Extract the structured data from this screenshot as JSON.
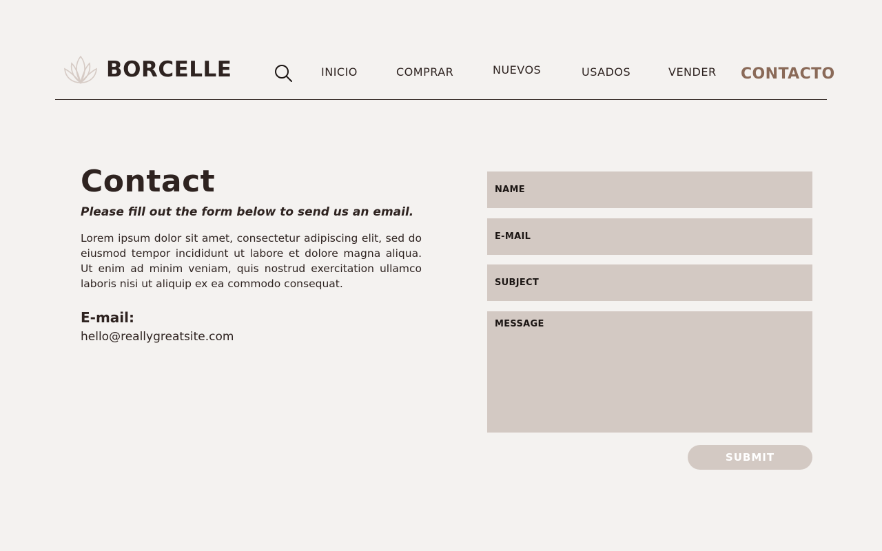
{
  "brand": {
    "name": "BORCELLE",
    "icon": "lotus-logo-icon"
  },
  "nav": {
    "search_icon": "search-icon",
    "items": [
      {
        "label": "INICIO"
      },
      {
        "label": "COMPRAR"
      },
      {
        "label": "NUEVOS"
      },
      {
        "label": "USADOS"
      },
      {
        "label": "VENDER"
      },
      {
        "label": "CONTACTO",
        "active": true
      }
    ]
  },
  "contact": {
    "title": "Contact",
    "subtitle": "Please fill out the form below to send us an email.",
    "body": "Lorem ipsum dolor sit amet, consectetur adipiscing elit, sed do eiusmod tempor incididunt ut labore et dolore magna aliqua. Ut enim ad minim veniam, quis nostrud exercitation ullamco laboris nisi ut aliquip ex ea commodo consequat.",
    "email_label": "E-mail:",
    "email_value": "hello@reallygreatsite.com"
  },
  "form": {
    "name_placeholder": "NAME",
    "email_placeholder": "E-MAIL",
    "subject_placeholder": "SUBJECT",
    "message_placeholder": "MESSAGE",
    "submit_label": "SUBMIT"
  },
  "colors": {
    "background": "#f4f2f0",
    "text": "#2e2320",
    "accent": "#8a6a58",
    "field": "#d3c9c3",
    "logo": "#d6cbc5"
  }
}
